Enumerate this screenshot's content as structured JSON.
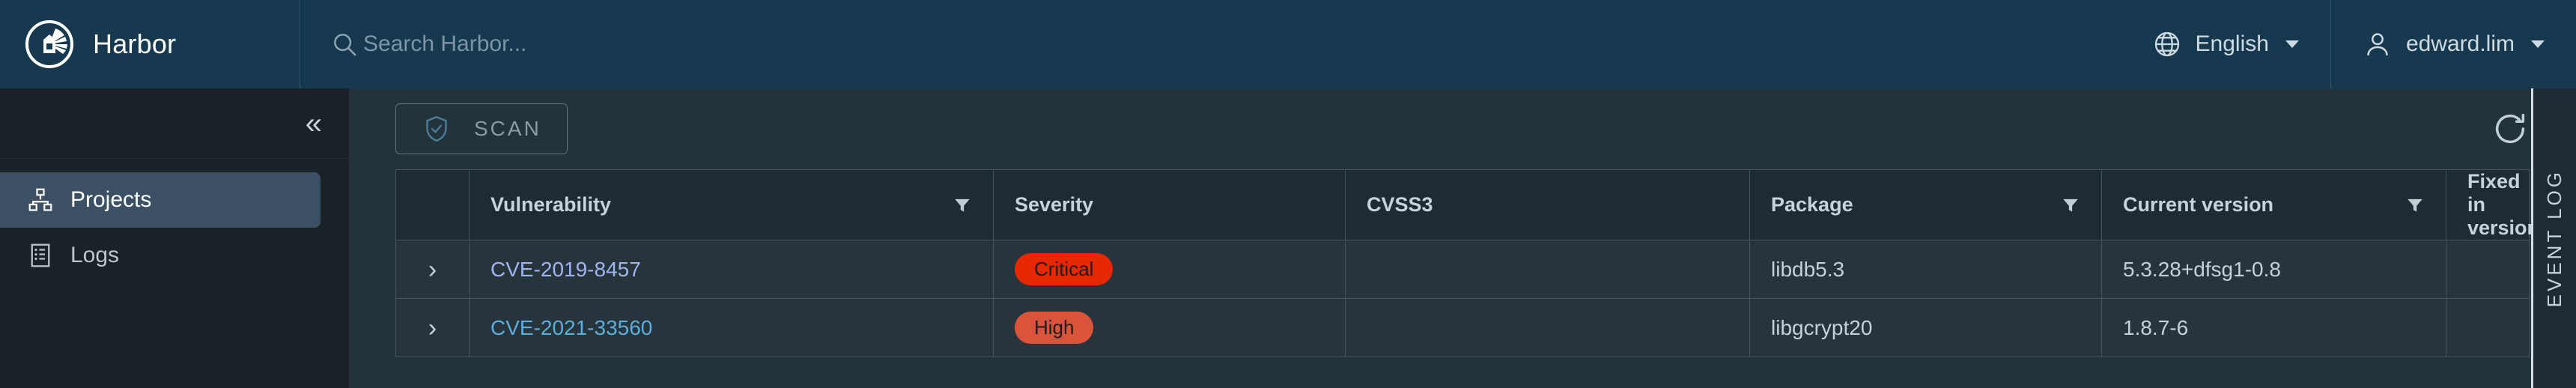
{
  "header": {
    "brand": "Harbor",
    "logo_icon": "harbor-lighthouse-logo",
    "search": {
      "icon": "search-icon",
      "placeholder": "Search Harbor...",
      "value": ""
    },
    "language": {
      "icon": "globe-icon",
      "label": "English",
      "caret_icon": "chevron-down-icon"
    },
    "user": {
      "icon": "user-icon",
      "label": "edward.lim",
      "caret_icon": "chevron-down-icon"
    }
  },
  "sidebar": {
    "collapse_icon": "double-chevron-left-icon",
    "collapse_label": "«",
    "items": [
      {
        "label": "Projects",
        "icon": "hierarchy-icon",
        "active": true
      },
      {
        "label": "Logs",
        "icon": "list-document-icon",
        "active": false
      }
    ]
  },
  "toolbar": {
    "scan_label": "SCAN",
    "scan_icon": "shield-check-icon",
    "refresh_icon": "refresh-icon"
  },
  "table": {
    "columns": [
      {
        "label": "",
        "filter": false
      },
      {
        "label": "Vulnerability",
        "filter": true
      },
      {
        "label": "Severity",
        "filter": false
      },
      {
        "label": "CVSS3",
        "filter": false
      },
      {
        "label": "Package",
        "filter": true
      },
      {
        "label": "Current version",
        "filter": true
      },
      {
        "label": "Fixed in version",
        "filter": true
      }
    ],
    "rows": [
      {
        "expand_icon": "chevron-right-icon",
        "vulnerability": "CVE-2019-8457",
        "severity": "Critical",
        "severity_color": "#e62700",
        "cvss3": "",
        "package": "libdb5.3",
        "current_version": "5.3.28+dfsg1-0.8",
        "fixed_in_version": ""
      },
      {
        "expand_icon": "chevron-right-icon",
        "vulnerability": "CVE-2021-33560",
        "severity": "High",
        "severity_color": "#d9543a",
        "cvss3": "",
        "package": "libgcrypt20",
        "current_version": "1.8.7-6",
        "fixed_in_version": ""
      }
    ]
  },
  "event_log": {
    "label": "EVENT LOG"
  },
  "colors": {
    "header_bg": "#16394f",
    "sidebar_bg": "#1b2227",
    "content_bg": "#22333b",
    "table_header_bg": "#1e2b33",
    "table_row_bg": "#27343c",
    "border": "#46565f",
    "active_nav": "#3b5064",
    "link": "#9fb4f0",
    "link_alt": "#5aaedd"
  }
}
